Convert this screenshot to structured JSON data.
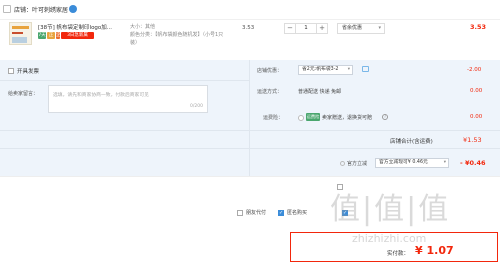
{
  "shop": {
    "store_label": "店铺：叶可刺绣家居",
    "icon": "store-icon"
  },
  "product": {
    "title": "[38节] 帆布袋定制印logo加...",
    "tags": {
      "seven": "7天",
      "zheng": "正品",
      "qi": "企",
      "new": "3日急新属"
    },
    "spec_size": "大小：其他",
    "spec_color": "颜色分类：【帆布袋颜色随机发】（小号1只装）",
    "spec_color_line2": "号1只装）",
    "price": "3.53",
    "quantity": "1",
    "promo": "省余优惠",
    "subtotal": "3.53"
  },
  "options": {
    "invoice_label": "开具发票",
    "message_label": "给卖家留言：",
    "message_placeholder": "选填，请先和商家协商一致，付款后商家可见",
    "message_counter": "0/200",
    "coupon_label": "店铺优惠：",
    "coupon_value": "省2元:帆布袋3-2",
    "coupon_amount": "-2.00",
    "delivery_label": "运送方式：",
    "delivery_value": "普通配送 快递 免邮",
    "delivery_amount": "0.00",
    "gift_label": "运费险：",
    "gift_tag": "运费险",
    "gift_text": "卖家赠送，退换货可赔",
    "gift_amount": "0.00",
    "shop_total_label": "店铺合计(含运费)",
    "shop_total_value": "¥1.53"
  },
  "platform": {
    "label": "官方立减",
    "select_value": "官方立减现可¥ 0.46元",
    "amount": "- ¥0.46"
  },
  "bottom_options": {
    "anon_label": "匿名购买",
    "proxy_label": "朋友代付"
  },
  "pay": {
    "label": "实付款：",
    "amount": "¥ 1.07"
  },
  "watermark": {
    "text": "值|值|值",
    "sub": "zhizhizhi.com"
  },
  "colors": {
    "accent": "#f2270c",
    "link": "#3b8cd9",
    "panel": "#eef4fb"
  }
}
